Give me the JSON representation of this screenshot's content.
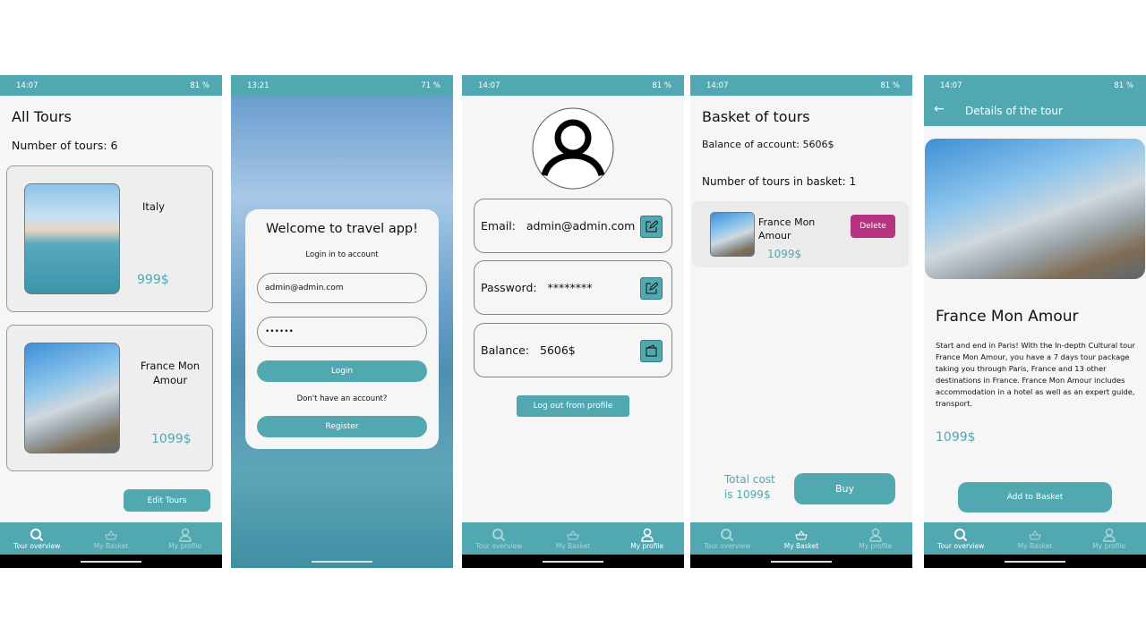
{
  "colors": {
    "accent": "#52a8b0",
    "delete": "#b8337f"
  },
  "status": {
    "time_a": "14:07",
    "time_b": "13:21",
    "battery_a": "81 %",
    "battery_b": "71 %"
  },
  "nav": {
    "overview": "Tour overview",
    "basket": "My Basket",
    "profile": "My profile"
  },
  "tours": {
    "title": "All Tours",
    "count": "Number of tours: 6",
    "items": [
      {
        "name": "Italy",
        "price": "999$"
      },
      {
        "name": "France Mon Amour",
        "price": "1099$"
      }
    ],
    "edit": "Edit Tours"
  },
  "login": {
    "title": "Welcome to travel app!",
    "subtitle": "Login in to account",
    "email": "admin@admin.com",
    "password": "••••••",
    "login": "Login",
    "no_account": "Don't have an account?",
    "register": "Register"
  },
  "profile": {
    "email_label": "Email:",
    "email": "admin@admin.com",
    "password_label": "Password:",
    "password": "********",
    "balance_label": "Balance:",
    "balance": "5606$",
    "logout": "Log out from profile"
  },
  "basket": {
    "title": "Basket of tours",
    "balance": "Balance of account: 5606$",
    "count": "Number of tours in basket: 1",
    "item": {
      "name": "France Mon Amour",
      "price": "1099$"
    },
    "delete": "Delete",
    "total": "Total cost is 1099$",
    "buy": "Buy"
  },
  "details": {
    "header": "Details of the tour",
    "name": "France Mon Amour",
    "description": "Start and end in Paris! With the In-depth Cultural tour France Mon Amour, you have a 7 days tour package taking you through Paris, France and 13 other destinations in France. France Mon Amour includes accommodation in a hotel as well as an expert guide, transport.",
    "price": "1099$",
    "add": "Add to Basket"
  }
}
